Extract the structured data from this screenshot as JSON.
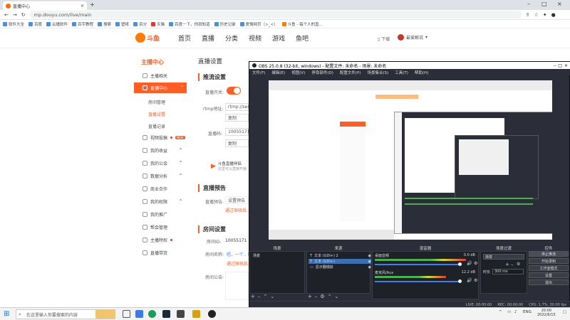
{
  "browser": {
    "tab_title": "直播中心",
    "url": "mp.douyu.com/live/main",
    "bookmarks": [
      "软件大全",
      "百度",
      "云播软件",
      "百宇教程",
      "搜索",
      "壁纸",
      "百分",
      "天猫",
      "百度一下，你就知道",
      "历史记录",
      "爱情网页（>_<）",
      "斗鱼 - 每个人的直..."
    ]
  },
  "site": {
    "logo_text": "斗鱼",
    "logo_sub": "DOUYU.COM",
    "nav": [
      "首页",
      "直播",
      "分类",
      "视频",
      "游戏",
      "鱼吧"
    ],
    "download": "下载",
    "user": "最爱解说"
  },
  "sidebar": {
    "title": "主播中心",
    "items": [
      {
        "label": "主播相关"
      },
      {
        "label": "直播中心",
        "active": true
      },
      {
        "label": "房间管理",
        "sub": true
      },
      {
        "label": "直播设置",
        "sub": true,
        "on": true
      },
      {
        "label": "直播记录",
        "sub": true
      },
      {
        "label": "视频投稿",
        "badge": "NEW"
      },
      {
        "label": "我的收益"
      },
      {
        "label": "我的公会"
      },
      {
        "label": "数据分析"
      },
      {
        "label": "商业合作"
      },
      {
        "label": "我的权限"
      },
      {
        "label": "我的推广"
      },
      {
        "label": "帮会管理"
      },
      {
        "label": "主播特权"
      },
      {
        "label": "直播带货"
      }
    ]
  },
  "main": {
    "title": "直播设置",
    "stream_section": "推流设置",
    "live_switch_label": "直播开关:",
    "rtmp_label": "rtmp地址:",
    "rtmp_value": "rtmp://sen",
    "copy_label": "复制",
    "key_label": "直播码:",
    "key_value": "10055171",
    "promo_text": "斗鱼直播伴侣",
    "promo_sub": "这里可以直接开播",
    "preview_section": "直播预告",
    "preview_label": "直播预告:",
    "preview_placeholder": "设置预告",
    "preview_link": "通过审核后...",
    "room_section": "房间设置",
    "room_id_label": "房间ID:",
    "room_id_value": "10055171",
    "room_name_label": "房间名称:",
    "room_name_value": "唱.. 一个.. 每!",
    "room_notice_label": "房间公告:"
  },
  "obs": {
    "title": "OBS 25.0.8 (32-bit, windows) - 配置文件: 未命名 - 场景: 未命名",
    "menu": [
      "文件(F)",
      "编辑(E)",
      "视图(V)",
      "停靠部件(D)",
      "配置文件(P)",
      "场景集合(S)",
      "工具(T)",
      "帮助(H)"
    ],
    "panels": {
      "scenes": "场景",
      "sources": "来源",
      "mixer": "混音器",
      "transitions": "场景过渡",
      "controls": "控件"
    },
    "scene_item": "场景",
    "sources": [
      "文本 (GDI+) 2",
      "文本 (GDI+)",
      "显示器捕获"
    ],
    "mixer_tracks": [
      {
        "name": "桌面音频",
        "level": "0.0 dB"
      },
      {
        "name": "麦克风/Aux",
        "level": "12.2 dB"
      }
    ],
    "transition_type": "渐变",
    "duration_label": "时长",
    "duration_value": "300 ms",
    "controls": [
      "停止推流",
      "开始录制",
      "工作室模式",
      "设置",
      "退出"
    ],
    "status": [
      "LIVE: 00:00:00",
      "REC: 00:00:00",
      "CPU: 1.7%, 30.00 fps"
    ]
  },
  "taskbar": {
    "search_placeholder": "在这里输入你要搜索的内容",
    "lang": "ENG",
    "time": "20:00",
    "date": "2022/6/15"
  }
}
